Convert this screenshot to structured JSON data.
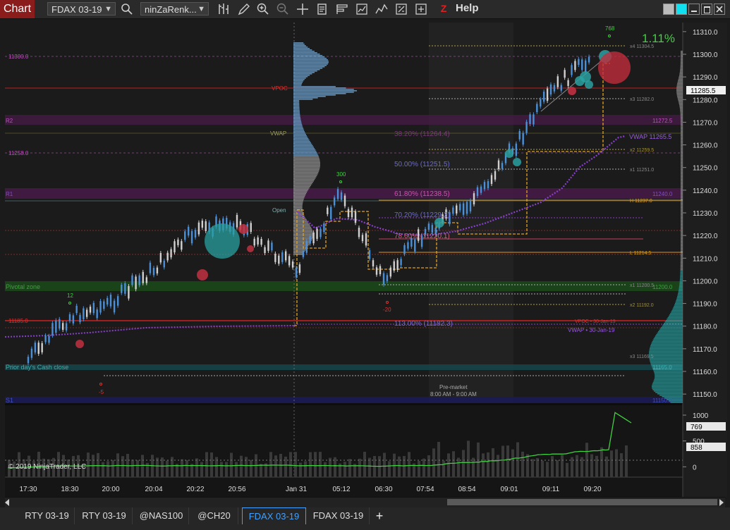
{
  "app": {
    "title": "Chart",
    "help_label": "Help",
    "instrument_select": "FDAX 03-19",
    "chart_type_select": "ninZaRenk...",
    "copyright": "© 2019 NinjaTrader, LLC",
    "session_note_line1": "Pre-market",
    "session_note_line2": "8:00 AM - 9:00 AM",
    "percent_change": "1.11%"
  },
  "toolbar": {
    "icons": [
      "search-icon",
      "bars-icon",
      "pencil-icon",
      "zoom-in-icon",
      "zoom-out-icon",
      "crosshair-icon",
      "properties-icon",
      "templates-icon",
      "strategy-icon",
      "indicators-icon",
      "data-box-icon",
      "trade-icon",
      "ninzaco-icon"
    ]
  },
  "window_controls": [
    "color-swatch-icon",
    "cyan-swatch-icon",
    "minimize-icon",
    "maximize-icon",
    "close-icon"
  ],
  "price_axis": {
    "ticks": [
      "11310.0",
      "11300.0",
      "11290.0",
      "11280.0",
      "11270.0",
      "11260.0",
      "11250.0",
      "11240.0",
      "11230.0",
      "11220.0",
      "11210.0",
      "11200.0",
      "11190.0",
      "11180.0",
      "11170.0",
      "11160.0",
      "11150.0"
    ],
    "current_price": "11285.5"
  },
  "volume_axis": {
    "ticks": [
      "1000",
      "500",
      "0"
    ],
    "badge_top": "769",
    "badge_bottom": "858"
  },
  "time_axis": [
    "17:30",
    "18:30",
    "20:00",
    "20:04",
    "20:22",
    "20:56",
    "Jan 31",
    "05:12",
    "06:30",
    "07:54",
    "08:54",
    "09:01",
    "09:11",
    "09:20"
  ],
  "left_labels": {
    "p11300": "11300.0",
    "vpoc": "VPOC",
    "r2": "R2",
    "vwap": "VWAP",
    "p11258": "11258.0",
    "open": "Open",
    "pivotal": "Pivotal zone",
    "p11185": "11185.0",
    "prior_close": "Prior day's Cash close",
    "s1": "S1"
  },
  "fib_labels": {
    "f38": "38.20% (11264.4)",
    "f50": "50.00% (11251.5)",
    "f61": "61.80% (11238.5)",
    "f70": "70.20% (11229.3)",
    "f78": "78.60% (11220.1)",
    "f113": "113.00% (11182.3)"
  },
  "right_labels": {
    "x4": "x4 11304.5",
    "x3a": "x3 11282.0",
    "r2": "11272.5",
    "vwap": "VWAP 11265.5",
    "x2a": "x2 11259.5",
    "x1a": "x1 11251.0",
    "r1": "11240.0",
    "h": "H 11237.0",
    "l": "L 11214.5",
    "x1b": "x1 11200.5",
    "pivot": "11200.0",
    "x2b": "x2 11192.0",
    "vpoc30": "VPOC • 30-Jan-19",
    "vwap30": "VWAP • 30-Jan-19",
    "x3b": "x3 11169.5",
    "close": "11165.0",
    "s1": "11150.0"
  },
  "annotations": {
    "a768": "768",
    "a300": "300",
    "a12": "12",
    "a20": "-20",
    "a5": "-5"
  },
  "tabs": [
    "RTY 03-19",
    "RTY 03-19",
    "@NAS100",
    "@CH20",
    "FDAX 03-19",
    "FDAX 03-19"
  ],
  "active_tab_index": 4,
  "chart_data": {
    "type": "line",
    "title": "",
    "series": [
      {
        "name": "",
        "x": [
          "17:30",
          "18:30",
          "20:00",
          "20:04",
          "20:22",
          "20:56",
          "Jan 31",
          "05:12",
          "06:30",
          "07:54",
          "08:54",
          "09:01",
          "09:11",
          "09:20"
        ],
        "values": [
          11165,
          11184,
          11190,
          11205,
          11222,
          11226,
          11205,
          11239,
          11200,
          11222,
          11232,
          11256,
          11283,
          11300
        ]
      }
    ],
    "ylim": [
      11146,
      11314
    ],
    "volume_ylim": [
      -200,
      1150
    ]
  },
  "colors": {
    "up": "#4a90d9",
    "down": "#d0d0d0",
    "fib": "#c45ac4",
    "vwap": "#8a3fd1",
    "ma": "#e0a020",
    "accent": "#3fa0ff",
    "percent": "#4cd040"
  }
}
